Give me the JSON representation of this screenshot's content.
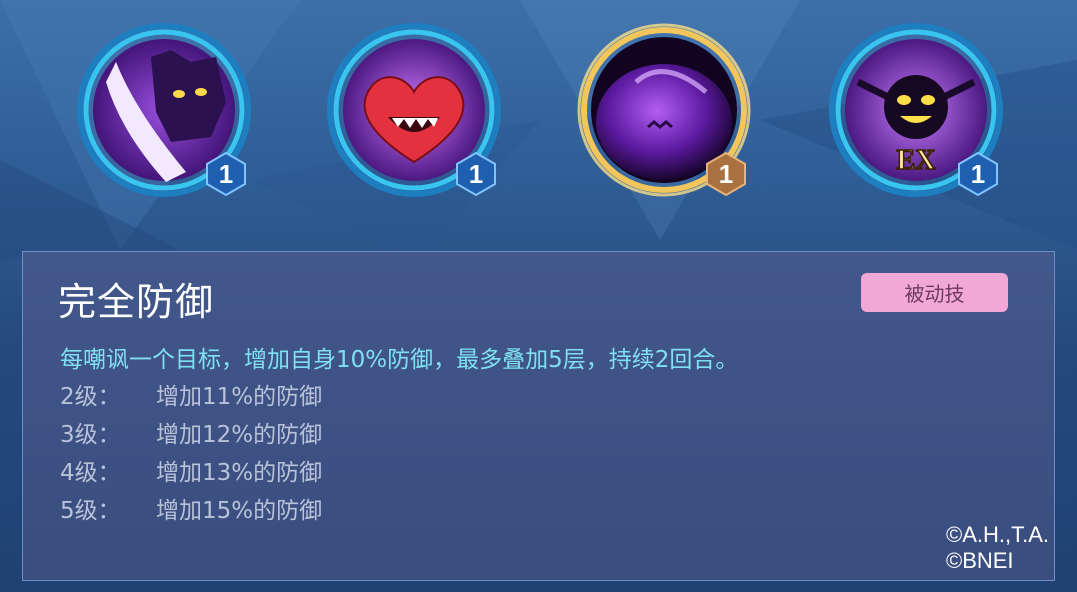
{
  "skills": [
    {
      "icon": "purple-claw-monster-icon",
      "level": "1",
      "selected": false
    },
    {
      "icon": "red-heart-fangs-icon",
      "level": "1",
      "selected": false
    },
    {
      "icon": "purple-orb-icon",
      "level": "1",
      "selected": true
    },
    {
      "icon": "ex-shadow-demon-icon",
      "level": "1",
      "selected": false,
      "label": "EX"
    }
  ],
  "detail": {
    "name": "完全防御",
    "type_tag": "被动技",
    "description": "每嘲讽一个目标，增加自身10%防御，最多叠加5层，持续2回合。",
    "levels": [
      {
        "level": "2级：",
        "effect": "增加11%的防御"
      },
      {
        "level": "3级：",
        "effect": "增加12%的防御"
      },
      {
        "level": "4级：",
        "effect": "增加13%的防御"
      },
      {
        "level": "5级：",
        "effect": "增加15%的防御"
      }
    ]
  },
  "copyright": {
    "line1": "©A.H.,T.A.",
    "line2": "©BNEI"
  },
  "colors": {
    "description": "#7fe0f2",
    "tag_bg": "#f1a8d6",
    "ring_blue": "#38c6f0",
    "ring_gold": "#f2c65a",
    "badge_blue": "#1f5fb0",
    "badge_bronze": "#a8713f"
  }
}
